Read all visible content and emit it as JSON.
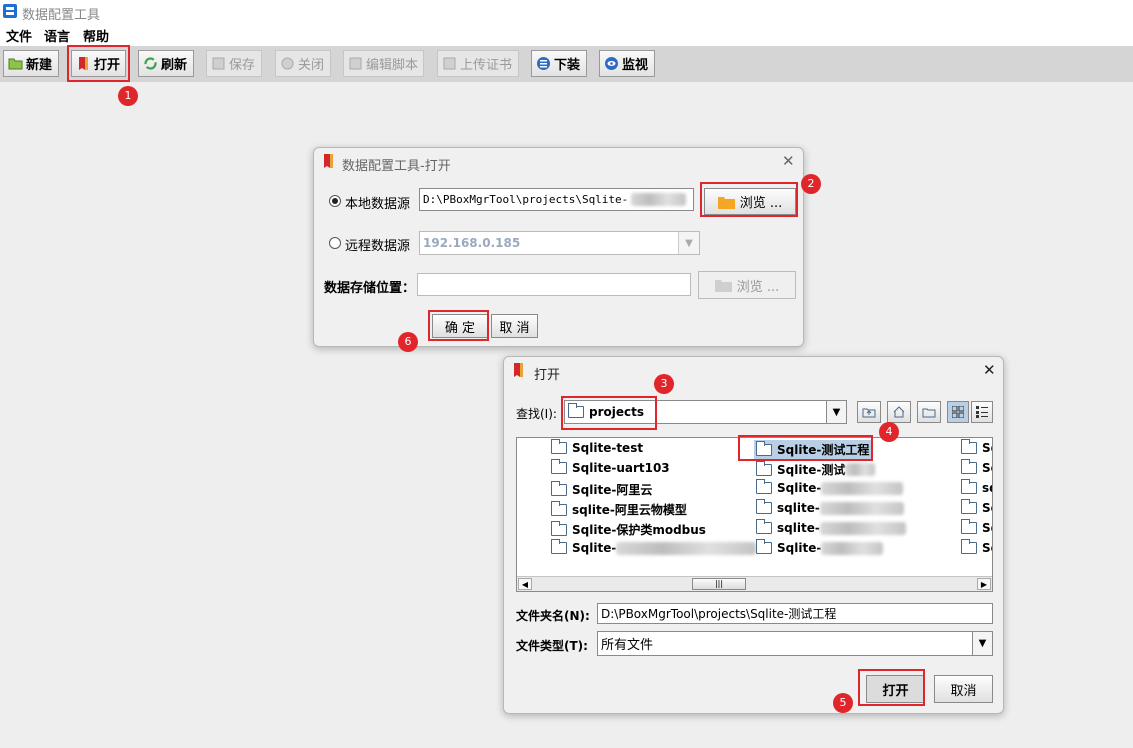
{
  "app": {
    "title": "数据配置工具"
  },
  "menu": [
    "文件",
    "语言",
    "帮助"
  ],
  "toolbar": {
    "new": "新建",
    "open": "打开",
    "refresh": "刷新",
    "save": "保存",
    "close": "关闭",
    "edit_script": "编辑脚本",
    "upload_cert": "上传证书",
    "download": "下装",
    "monitor": "监视"
  },
  "steps": [
    "1",
    "2",
    "3",
    "4",
    "5",
    "6"
  ],
  "open_dialog": {
    "title": "数据配置工具-打开",
    "local_label": "本地数据源",
    "local_path": "D:\\PBoxMgrTool\\projects\\Sqlite-",
    "browse": "浏览 ...",
    "remote_label": "远程数据源",
    "remote_value": "192.168.0.185",
    "storage_label": "数据存储位置：",
    "storage_value": "",
    "browse2": "浏览 ...",
    "ok": "确  定",
    "cancel": "取 消",
    "selected_source": "local"
  },
  "file_dialog": {
    "title": "打开",
    "lookin_label": "查找(I):",
    "lookin_value": "projects",
    "col1": [
      "Sqlite-test",
      "Sqlite-uart103",
      "Sqlite-阿里云",
      "sqlite-阿里云物模型",
      "Sqlite-保护类modbus",
      "Sqlite-"
    ],
    "col2": [
      "Sqlite-测试工程",
      "Sqlite-测试",
      "Sqlite-",
      "sqlite-",
      "sqlite-",
      "Sqlite-"
    ],
    "col3": [
      "Sq",
      "Sq",
      "sq",
      "Sq",
      "Sq",
      "Sq"
    ],
    "selected_item": "Sqlite-测试工程",
    "foldername_label": "文件夹名(N):",
    "foldername_value": "D:\\PBoxMgrTool\\projects\\Sqlite-测试工程",
    "filetype_label": "文件类型(T):",
    "filetype_value": "所有文件",
    "open": "打开",
    "cancel": "取消"
  },
  "colors": {
    "highlight": "#e0262a",
    "toolbar_bg": "#d5d5d5",
    "selection": "#b8cfe5"
  }
}
